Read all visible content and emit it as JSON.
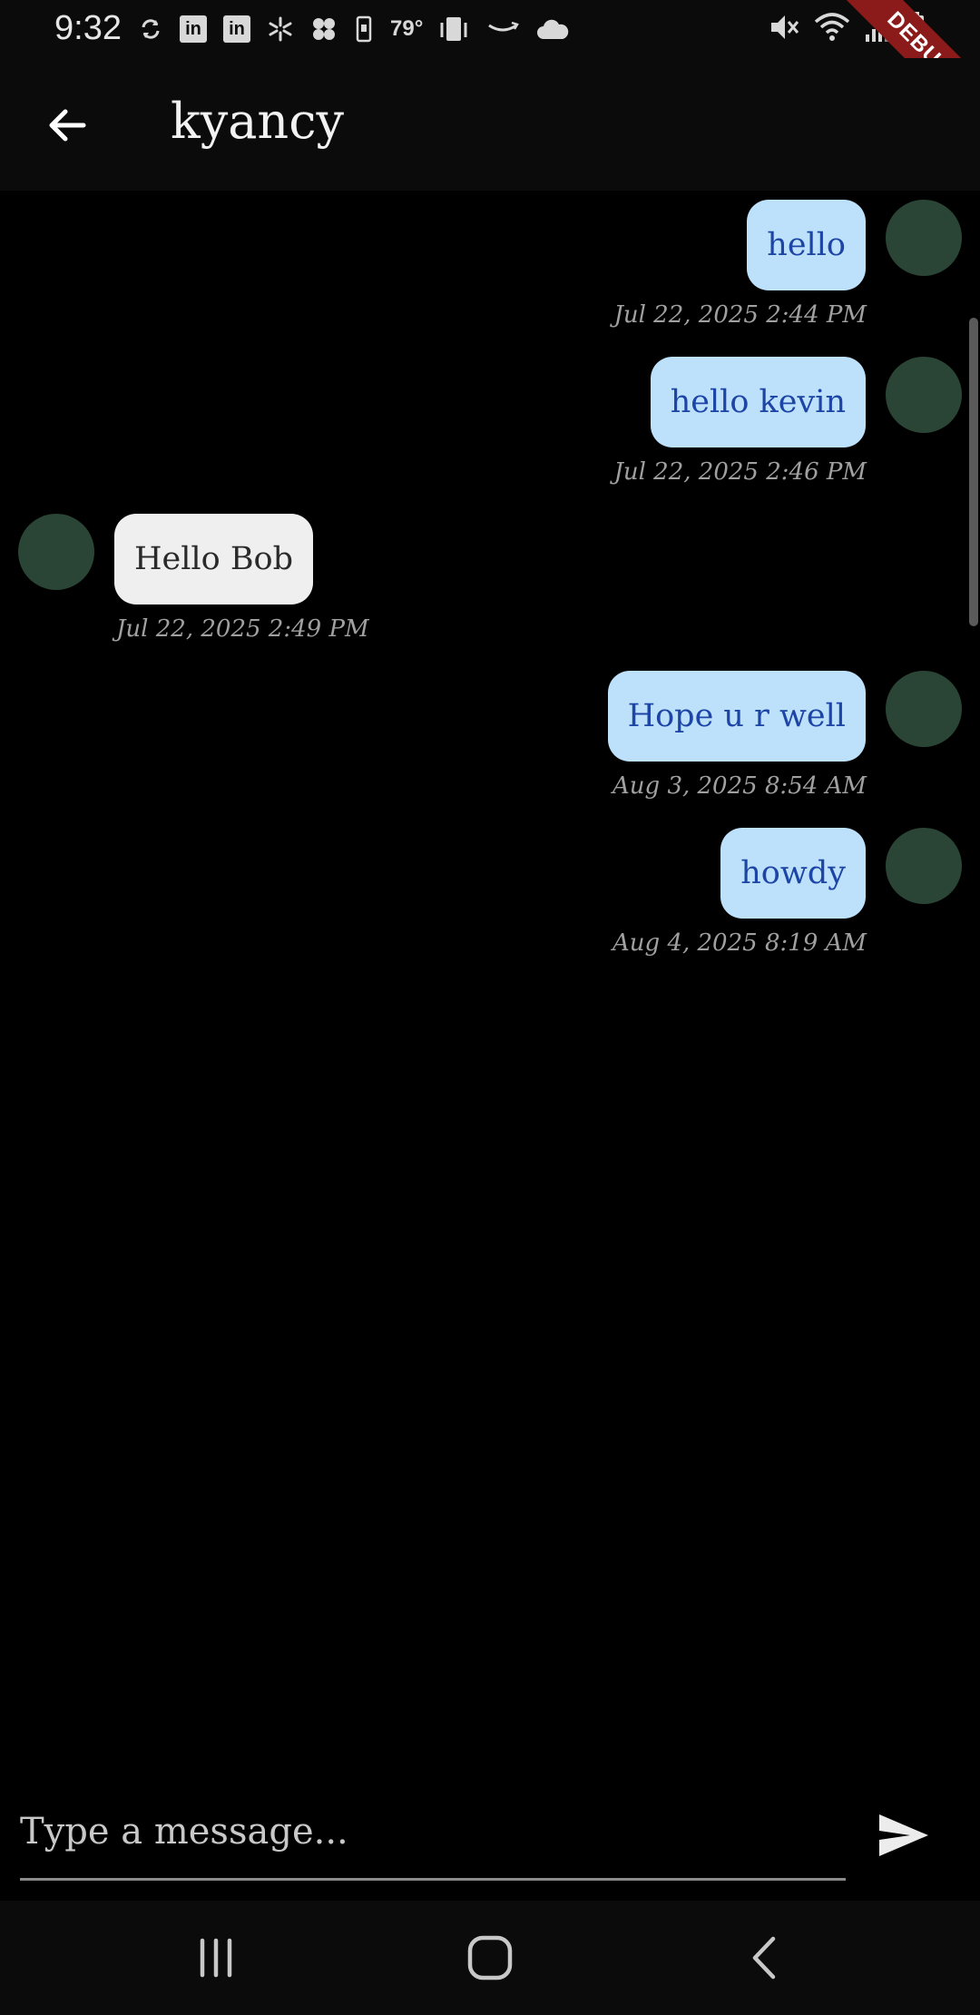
{
  "status_bar": {
    "time": "9:32",
    "temperature": "79°",
    "debug_label": "DEBUG",
    "linkedin_1": "in",
    "linkedin_2": "in"
  },
  "app_bar": {
    "title": "kyancy",
    "back_icon": "arrow-left-icon"
  },
  "messages": [
    {
      "text": "hello",
      "timestamp": "Jul 22, 2025 2:44 PM",
      "direction": "sent"
    },
    {
      "text": "hello kevin",
      "timestamp": "Jul 22, 2025 2:46 PM",
      "direction": "sent"
    },
    {
      "text": "Hello Bob",
      "timestamp": "Jul 22, 2025 2:49 PM",
      "direction": "received"
    },
    {
      "text": "Hope u r well",
      "timestamp": "Aug 3, 2025 8:54 AM",
      "direction": "sent"
    },
    {
      "text": "howdy",
      "timestamp": "Aug 4, 2025 8:19 AM",
      "direction": "sent"
    }
  ],
  "composer": {
    "placeholder": "Type a message...",
    "send_icon": "send-icon"
  },
  "nav_bar": {
    "recents_icon": "recents-icon",
    "home_icon": "home-icon",
    "back_icon": "nav-back-icon"
  },
  "colors": {
    "sent_bubble": "#bde0fb",
    "sent_text": "#1c45a6",
    "received_bubble": "#efefef",
    "avatar": "#2a4535",
    "background": "#000000"
  }
}
